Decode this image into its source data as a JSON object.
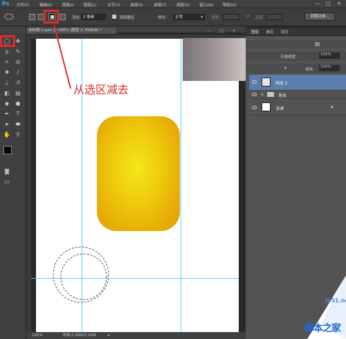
{
  "app": {
    "logo": "Ps"
  },
  "menu": [
    "文件(F)",
    "编辑(E)",
    "图像(I)",
    "图层(L)",
    "文字(Y)",
    "选择(S)",
    "滤镜(T)",
    "视图(V)",
    "窗口(W)",
    "帮助(H)"
  ],
  "window_buttons": [
    "—",
    "□",
    "×"
  ],
  "options": {
    "feather_label": "羽化:",
    "feather_value": "0 像素",
    "antialias_label": "消除锯齿",
    "antialias_checked": true,
    "style_label": "样式:",
    "style_value": "正常",
    "width_label": "宽度:",
    "height_label": "高度:",
    "refine_button": "调整边缘..."
  },
  "document": {
    "tab_title": "未标题-1.psd @ 100% (图层 2, RGB/8) *",
    "zoom": "100%",
    "doc_size": "文档:1.00M/2.14M"
  },
  "annotation": {
    "text": "从选区减去",
    "color": "#e32b27"
  },
  "layers_panel": {
    "tabs": [
      "图层",
      "通道",
      "路径"
    ],
    "opacity_label": "不透明度:",
    "opacity_value": "100%",
    "fill_label": "填充:",
    "fill_value": "100%",
    "layers": [
      {
        "name": "图层 2",
        "selected": true
      },
      {
        "name": "身体",
        "type": "group"
      },
      {
        "name": "背景",
        "locked": true
      }
    ]
  },
  "colors": {
    "accent_blue": "#31a8ff",
    "highlight_red": "#e32b27",
    "guide": "#49d2ff",
    "shape_yellow": "#eecb0c"
  },
  "watermark": {
    "domain": "jb51.net",
    "title": "脚本之家"
  }
}
